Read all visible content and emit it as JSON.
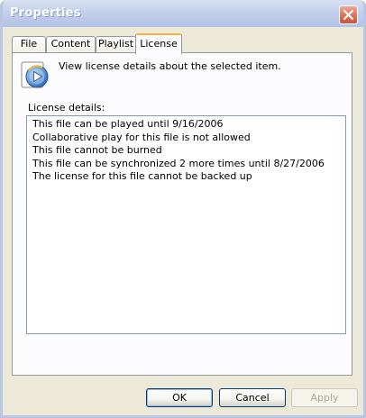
{
  "window": {
    "title": "Properties"
  },
  "tabs": [
    {
      "label": "File"
    },
    {
      "label": "Content"
    },
    {
      "label": "Playlist"
    },
    {
      "label": "License",
      "active": true
    }
  ],
  "panel": {
    "icon": "media-player-icon",
    "info_text": "View license details about the selected item.",
    "details_label": "License details:",
    "details": [
      "This file can be played until 9/16/2006",
      "Collaborative play for this file is not allowed",
      "This file cannot be burned",
      "This file can be synchronized 2 more times until 8/27/2006",
      "The license for this file cannot be backed up"
    ]
  },
  "buttons": {
    "ok": "OK",
    "cancel": "Cancel",
    "apply": "Apply"
  },
  "colors": {
    "title_bar": "#b3c3e6",
    "active_tab_accent": "#f1b33f",
    "dialog_bg": "#ece9d8"
  }
}
